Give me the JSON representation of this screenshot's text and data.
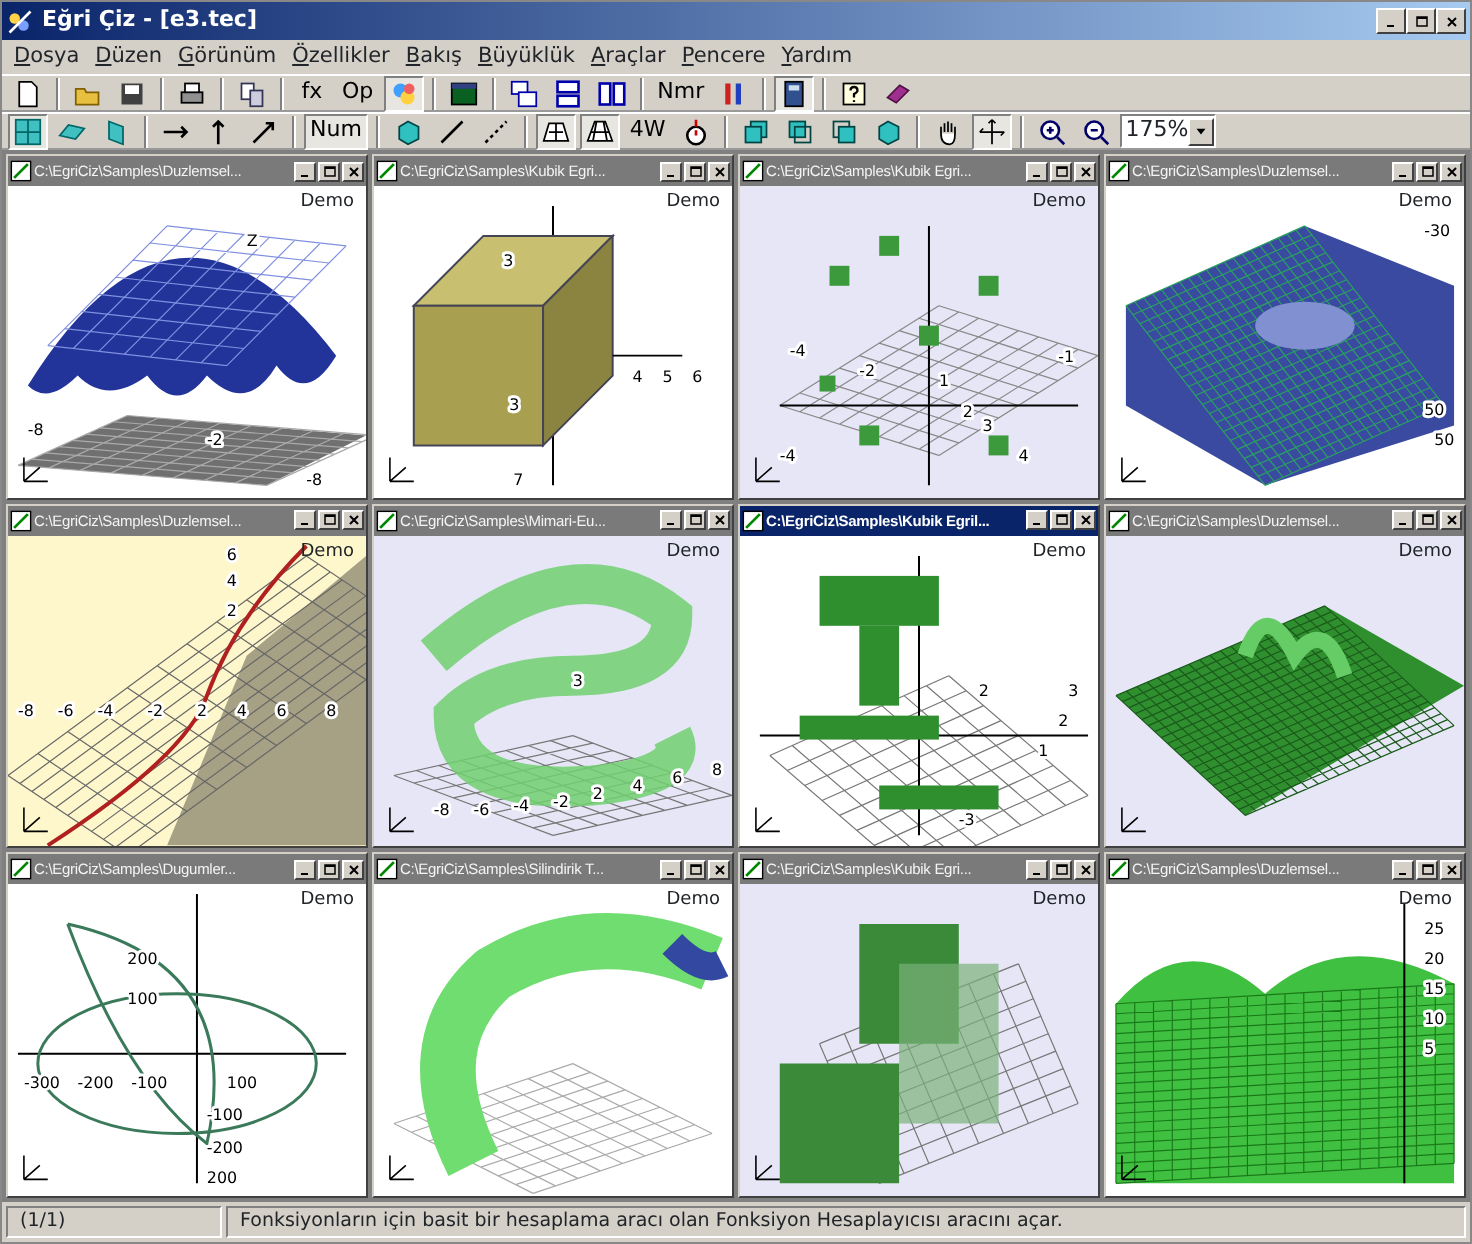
{
  "window": {
    "title": "Eğri Çiz - [e3.tec]"
  },
  "menu": [
    "Dosya",
    "Düzen",
    "Görünüm",
    "Özellikler",
    "Bakış",
    "Büyüklük",
    "Araçlar",
    "Pencere",
    "Yardım"
  ],
  "toolbar_1": [
    {
      "kind": "icon",
      "pressed": false
    },
    {
      "kind": "separator"
    },
    {
      "kind": "icon",
      "pressed": false
    },
    {
      "kind": "icon",
      "pressed": false
    },
    {
      "kind": "separator"
    },
    {
      "kind": "icon",
      "pressed": false
    },
    {
      "kind": "separator"
    },
    {
      "kind": "icon",
      "pressed": false
    },
    {
      "kind": "separator"
    },
    {
      "kind": "text",
      "label": "fx",
      "pressed": false
    },
    {
      "kind": "text",
      "label": "Op",
      "pressed": false
    },
    {
      "kind": "icon",
      "pressed": true
    },
    {
      "kind": "separator"
    },
    {
      "kind": "icon",
      "pressed": false
    },
    {
      "kind": "separator"
    },
    {
      "kind": "icon",
      "pressed": false
    },
    {
      "kind": "icon",
      "pressed": false
    },
    {
      "kind": "icon",
      "pressed": false
    },
    {
      "kind": "separator"
    },
    {
      "kind": "text",
      "label": "Nmr",
      "pressed": false
    },
    {
      "kind": "icon",
      "pressed": false
    },
    {
      "kind": "separator"
    },
    {
      "kind": "icon",
      "pressed": true
    },
    {
      "kind": "separator"
    },
    {
      "kind": "icon",
      "pressed": false
    },
    {
      "kind": "icon",
      "pressed": false
    }
  ],
  "toolbar_2": [
    {
      "kind": "icon",
      "pressed": true
    },
    {
      "kind": "icon",
      "pressed": false
    },
    {
      "kind": "icon",
      "pressed": false
    },
    {
      "kind": "separator"
    },
    {
      "kind": "icon",
      "pressed": false
    },
    {
      "kind": "icon",
      "pressed": false
    },
    {
      "kind": "icon",
      "pressed": false
    },
    {
      "kind": "separator"
    },
    {
      "kind": "text",
      "label": "Num",
      "pressed": true
    },
    {
      "kind": "separator"
    },
    {
      "kind": "icon",
      "pressed": false
    },
    {
      "kind": "icon",
      "pressed": false
    },
    {
      "kind": "icon",
      "pressed": false
    },
    {
      "kind": "separator"
    },
    {
      "kind": "icon",
      "pressed": true
    },
    {
      "kind": "icon",
      "pressed": true
    },
    {
      "kind": "text",
      "label": "4W",
      "pressed": false
    },
    {
      "kind": "icon",
      "pressed": false
    },
    {
      "kind": "separator"
    },
    {
      "kind": "icon",
      "pressed": false
    },
    {
      "kind": "icon",
      "pressed": false
    },
    {
      "kind": "icon",
      "pressed": false
    },
    {
      "kind": "icon",
      "pressed": false
    },
    {
      "kind": "separator"
    },
    {
      "kind": "icon",
      "pressed": false
    },
    {
      "kind": "icon",
      "pressed": true
    },
    {
      "kind": "separator"
    },
    {
      "kind": "icon",
      "pressed": false
    },
    {
      "kind": "icon",
      "pressed": false
    },
    {
      "kind": "combo",
      "value": "175%"
    }
  ],
  "child_windows": [
    {
      "title": "C:\\EgriCiz\\Samples\\Duzlemsel...",
      "active": false,
      "badge": "Demo",
      "labels": [
        "Z",
        "-8",
        "-2",
        "-8"
      ]
    },
    {
      "title": "C:\\EgriCiz\\Samples\\Kubik Egri...",
      "active": false,
      "badge": "Demo",
      "labels": [
        "3",
        "4",
        "5",
        "6",
        "3",
        "7"
      ]
    },
    {
      "title": "C:\\EgriCiz\\Samples\\Kubik Egri...",
      "active": false,
      "badge": "Demo",
      "labels": [
        "-4",
        "-1",
        "-2",
        "1",
        "2",
        "3",
        "-4",
        "4"
      ]
    },
    {
      "title": "C:\\EgriCiz\\Samples\\Duzlemsel...",
      "active": false,
      "badge": "Demo",
      "labels": [
        "-30",
        "50",
        "50"
      ]
    },
    {
      "title": "C:\\EgriCiz\\Samples\\Duzlemsel...",
      "active": false,
      "badge": "Demo",
      "labels": [
        "6",
        "4",
        "2",
        "-8",
        "-6",
        "-4",
        "-2",
        "2",
        "4",
        "6",
        "8"
      ]
    },
    {
      "title": "C:\\EgriCiz\\Samples\\Mimari-Eu...",
      "active": false,
      "badge": "Demo",
      "labels": [
        "-8",
        "-6",
        "-4",
        "-2",
        "2",
        "4",
        "6",
        "8",
        "3"
      ]
    },
    {
      "title": "C:\\EgriCiz\\Samples\\Kubik Egril...",
      "active": true,
      "badge": "Demo",
      "labels": [
        "2",
        "-3",
        "1",
        "2",
        "3"
      ]
    },
    {
      "title": "C:\\EgriCiz\\Samples\\Duzlemsel...",
      "active": false,
      "badge": "Demo"
    },
    {
      "title": "C:\\EgriCiz\\Samples\\Dugumler...",
      "active": false,
      "badge": "Demo",
      "labels": [
        "200",
        "100",
        "-300",
        "-200",
        "-100",
        "100",
        "-100",
        "-200",
        "200"
      ]
    },
    {
      "title": "C:\\EgriCiz\\Samples\\Silindirik T...",
      "active": false,
      "badge": "Demo"
    },
    {
      "title": "C:\\EgriCiz\\Samples\\Kubik Egri...",
      "active": false,
      "badge": "Demo"
    },
    {
      "title": "C:\\EgriCiz\\Samples\\Duzlemsel...",
      "active": false,
      "badge": "Demo",
      "labels": [
        "25",
        "20",
        "15",
        "10",
        "5"
      ]
    }
  ],
  "status_bar": {
    "page": "(1/1)",
    "message": "Fonksiyonların için basit bir hesaplama aracı olan Fonksiyon Hesaplayıcısı aracını  açar."
  }
}
